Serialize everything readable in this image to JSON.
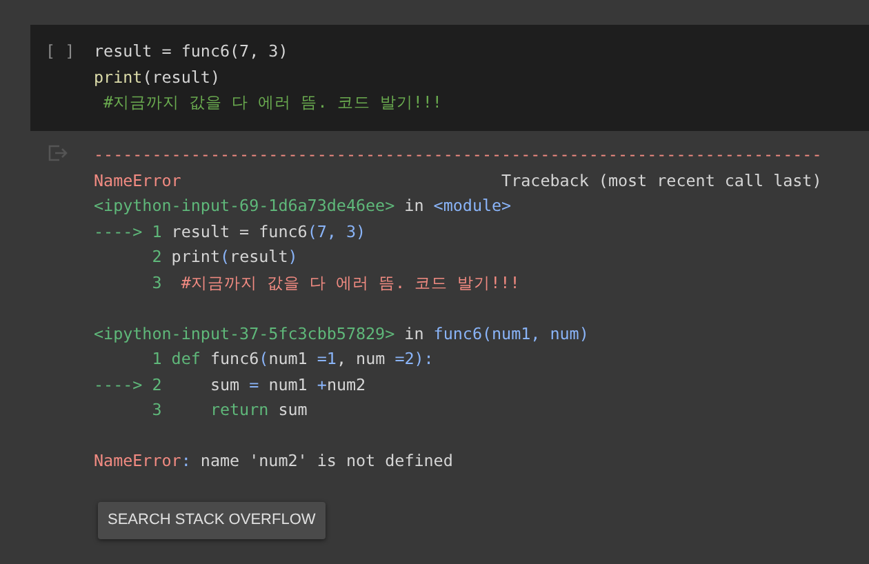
{
  "input_cell": {
    "run_marker": "[ ]",
    "lines": [
      [
        {
          "kind": "plain",
          "text": "result = func6(7, 3)"
        }
      ],
      [
        {
          "kind": "builtin",
          "text": "print"
        },
        {
          "kind": "plain",
          "text": "(result)"
        }
      ],
      [
        {
          "kind": "comment",
          "text": " #지금까지 값을 다 에러 뜸. 코드 발기!!!"
        }
      ]
    ]
  },
  "output": {
    "blocks": [
      [
        [
          {
            "kind": "red",
            "text": "---------------------------------------------------------------------------"
          }
        ],
        [
          {
            "kind": "red",
            "text": "NameError"
          },
          {
            "kind": "plain",
            "text": "                                 Traceback (most recent call last)"
          }
        ],
        [
          {
            "kind": "green",
            "text": "<ipython-input-69-1d6a73de46ee>"
          },
          {
            "kind": "plain",
            "text": " in "
          },
          {
            "kind": "blue",
            "text": "<module>"
          }
        ],
        [
          {
            "kind": "green",
            "text": "----> 1 "
          },
          {
            "kind": "plain",
            "text": "result = func6"
          },
          {
            "kind": "blue",
            "text": "(7, 3)"
          }
        ],
        [
          {
            "kind": "green",
            "text": "      2 "
          },
          {
            "kind": "plain",
            "text": "print"
          },
          {
            "kind": "blue",
            "text": "("
          },
          {
            "kind": "plain",
            "text": "result"
          },
          {
            "kind": "blue",
            "text": ")"
          }
        ],
        [
          {
            "kind": "green",
            "text": "      3  "
          },
          {
            "kind": "red",
            "text": "#지금까지 값을 다 에러 뜸. 코드 발기!!!"
          }
        ]
      ],
      [
        [
          {
            "kind": "green",
            "text": "<ipython-input-37-5fc3cbb57829>"
          },
          {
            "kind": "plain",
            "text": " in "
          },
          {
            "kind": "blue",
            "text": "func6(num1, num)"
          }
        ],
        [
          {
            "kind": "green",
            "text": "      1 def "
          },
          {
            "kind": "plain",
            "text": "func6"
          },
          {
            "kind": "blue",
            "text": "("
          },
          {
            "kind": "plain",
            "text": "num1 "
          },
          {
            "kind": "blue",
            "text": "=1"
          },
          {
            "kind": "plain",
            "text": ", num "
          },
          {
            "kind": "blue",
            "text": "=2):"
          }
        ],
        [
          {
            "kind": "green",
            "text": "----> 2     "
          },
          {
            "kind": "plain",
            "text": "sum "
          },
          {
            "kind": "blue",
            "text": "="
          },
          {
            "kind": "plain",
            "text": " num1 "
          },
          {
            "kind": "blue",
            "text": "+"
          },
          {
            "kind": "plain",
            "text": "num2"
          }
        ],
        [
          {
            "kind": "green",
            "text": "      3     return"
          },
          {
            "kind": "plain",
            "text": " sum"
          }
        ]
      ],
      [
        [
          {
            "kind": "red",
            "text": "NameError"
          },
          {
            "kind": "blue",
            "text": ": "
          },
          {
            "kind": "plain",
            "text": "name 'num2' is not defined"
          }
        ]
      ]
    ],
    "button": "SEARCH STACK OVERFLOW"
  }
}
